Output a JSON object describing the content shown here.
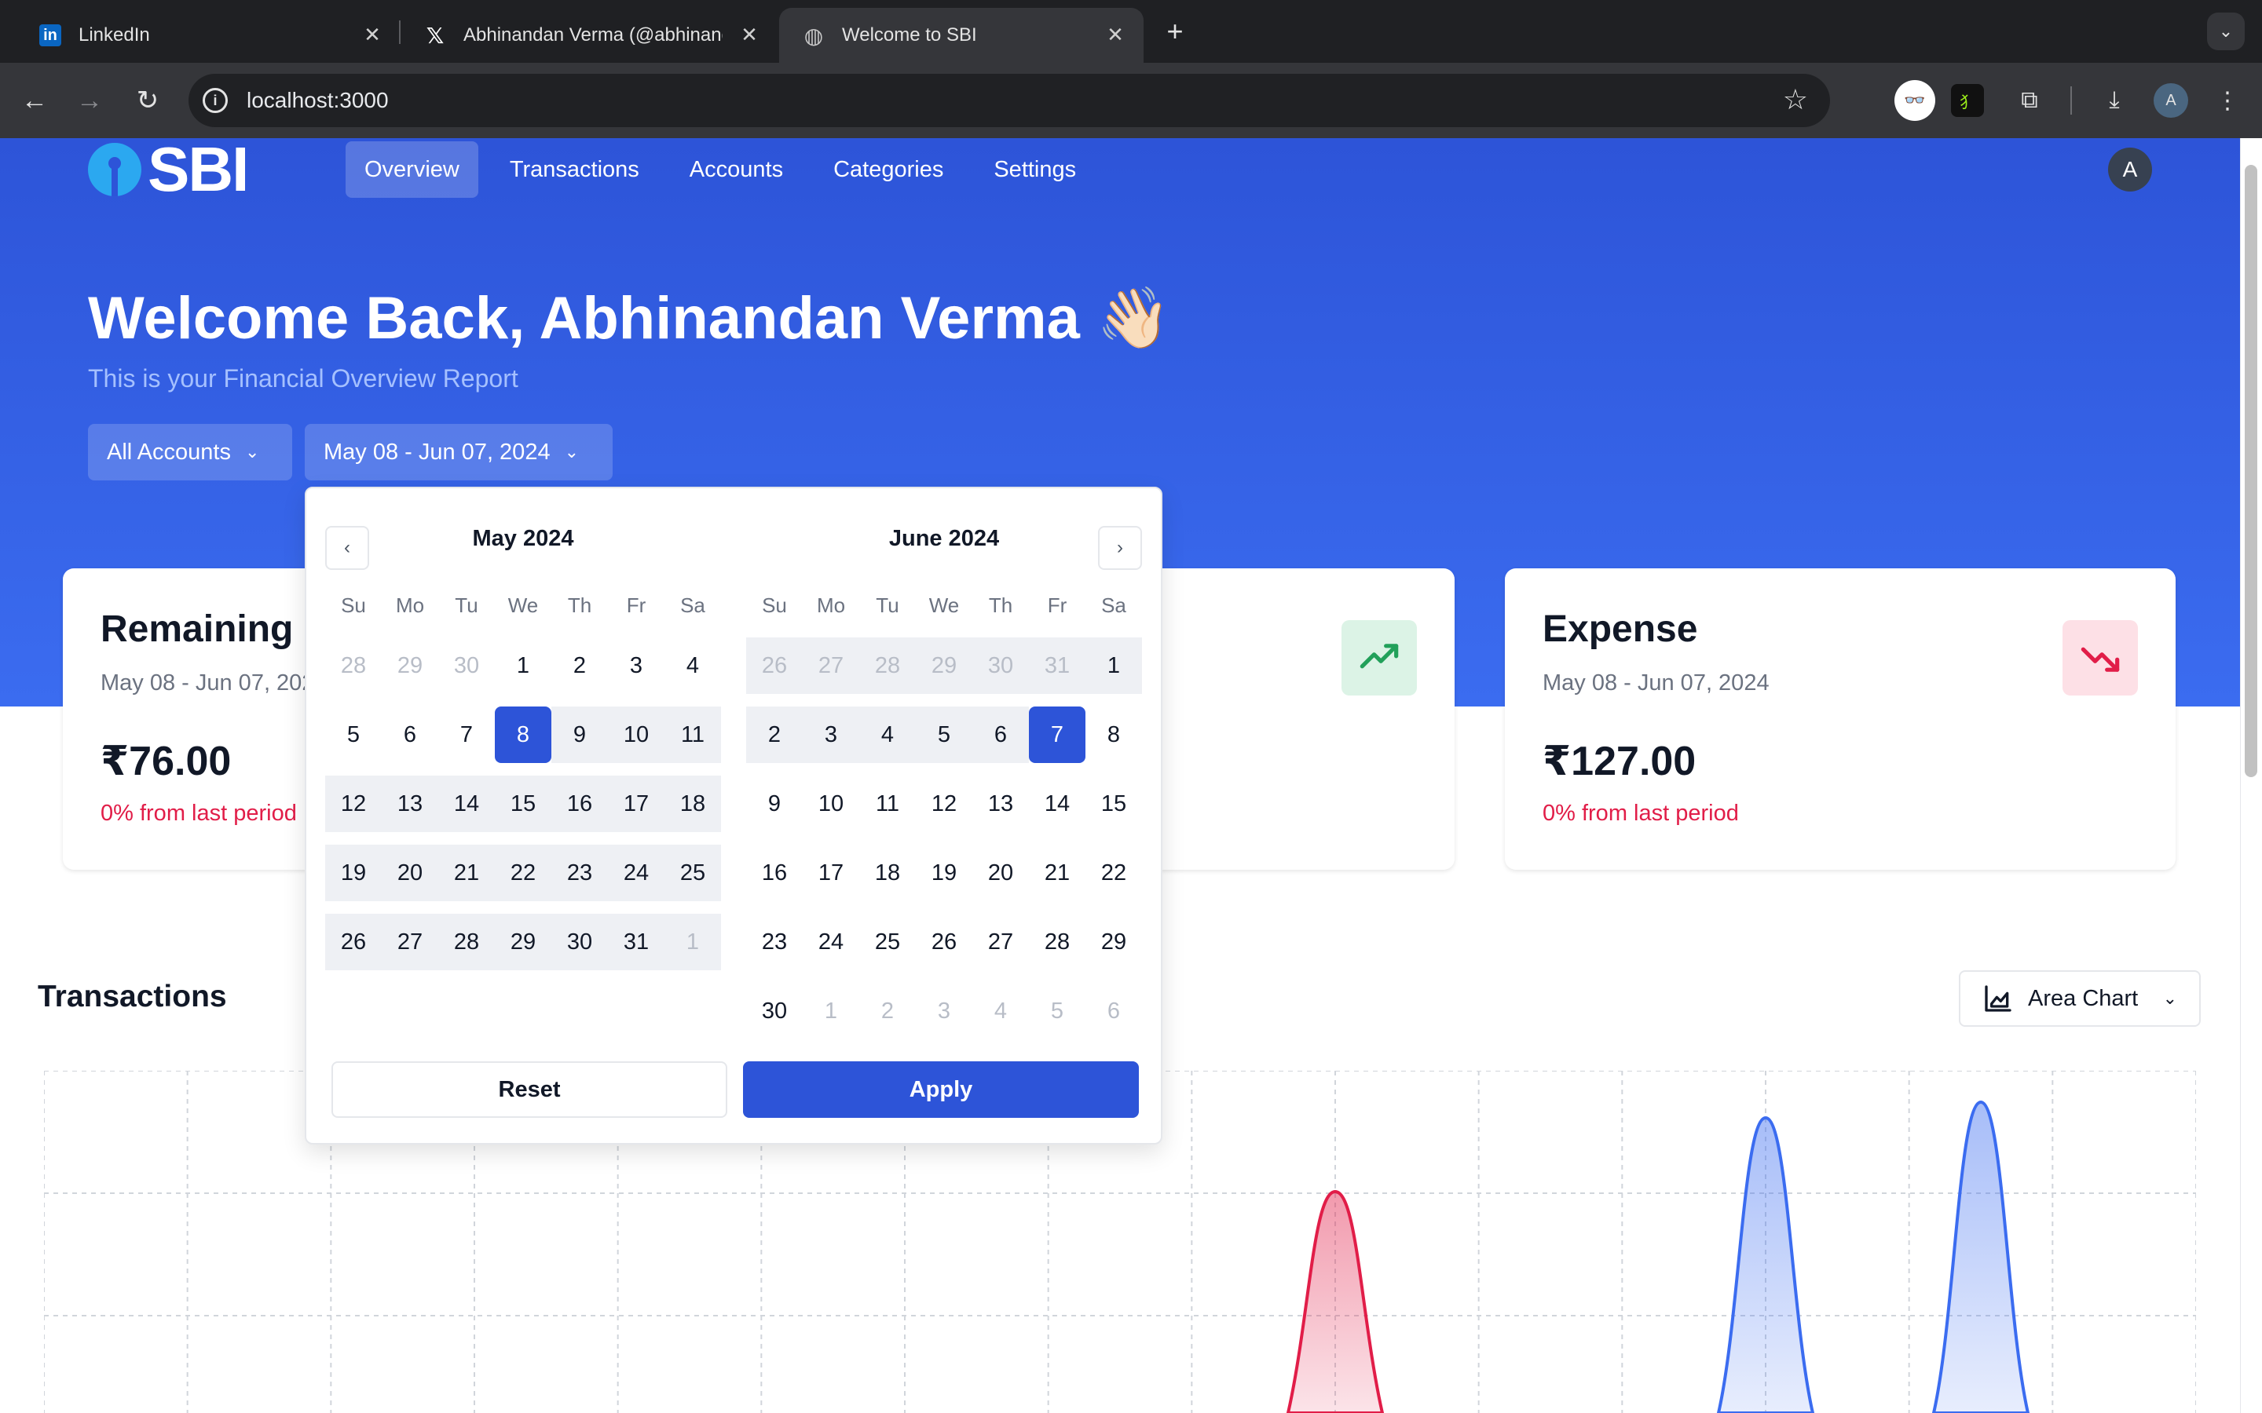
{
  "browser": {
    "tabs": [
      {
        "title": "LinkedIn",
        "icon": "linkedin-icon"
      },
      {
        "title": "Abhinandan Verma (@abhinandan",
        "icon": "x-icon"
      },
      {
        "title": "Welcome to SBI",
        "icon": "globe-icon"
      }
    ],
    "url": "localhost:3000",
    "profile_initial": "A"
  },
  "app": {
    "logo_text": "SBI",
    "brand_color": "#2d54d8",
    "nav": [
      "Overview",
      "Transactions",
      "Accounts",
      "Categories",
      "Settings"
    ],
    "active_nav": "Overview",
    "user_initial": "A",
    "welcome": "Welcome Back, Abhinandan Verma 👋🏻",
    "subtitle": "This is your Financial Overview Report",
    "filters": {
      "account": "All Accounts",
      "date_range": "May 08 - Jun 07, 2024"
    },
    "cards": [
      {
        "title": "Remaining",
        "range": "May 08 - Jun 07, 2024",
        "amount": "₹76.00",
        "change": "0% from last period"
      },
      {
        "title": "Expense",
        "range": "May 08 - Jun 07, 2024",
        "amount": "₹127.00",
        "change": "0% from last period",
        "trend": "down"
      }
    ],
    "income_trend": "up",
    "transactions": {
      "title": "Transactions",
      "chart_type_label": "Area Chart"
    }
  },
  "datepicker": {
    "weekdays": [
      "Su",
      "Mo",
      "Tu",
      "We",
      "Th",
      "Fr",
      "Sa"
    ],
    "months": [
      {
        "label": "May 2024",
        "weeks": [
          [
            [
              "28",
              "out"
            ],
            [
              "29",
              "out"
            ],
            [
              "30",
              "out"
            ],
            [
              "1",
              ""
            ],
            [
              "2",
              ""
            ],
            [
              "3",
              ""
            ],
            [
              "4",
              ""
            ]
          ],
          [
            [
              "5",
              ""
            ],
            [
              "6",
              ""
            ],
            [
              "7",
              ""
            ],
            [
              "8",
              "sel"
            ],
            [
              "9",
              "in"
            ],
            [
              "10",
              "in"
            ],
            [
              "11",
              "in"
            ]
          ],
          [
            [
              "12",
              "in"
            ],
            [
              "13",
              "in"
            ],
            [
              "14",
              "in"
            ],
            [
              "15",
              "in"
            ],
            [
              "16",
              "in"
            ],
            [
              "17",
              "in"
            ],
            [
              "18",
              "in"
            ]
          ],
          [
            [
              "19",
              "in"
            ],
            [
              "20",
              "in"
            ],
            [
              "21",
              "in"
            ],
            [
              "22",
              "in"
            ],
            [
              "23",
              "in"
            ],
            [
              "24",
              "in"
            ],
            [
              "25",
              "in"
            ]
          ],
          [
            [
              "26",
              "in"
            ],
            [
              "27",
              "in"
            ],
            [
              "28",
              "in"
            ],
            [
              "29",
              "in"
            ],
            [
              "30",
              "in"
            ],
            [
              "31",
              "in"
            ],
            [
              "1",
              "outin"
            ]
          ]
        ]
      },
      {
        "label": "June 2024",
        "weeks": [
          [
            [
              "26",
              "outin"
            ],
            [
              "27",
              "outin"
            ],
            [
              "28",
              "outin"
            ],
            [
              "29",
              "outin"
            ],
            [
              "30",
              "outin"
            ],
            [
              "31",
              "outin"
            ],
            [
              "1",
              "in"
            ]
          ],
          [
            [
              "2",
              "in"
            ],
            [
              "3",
              "in"
            ],
            [
              "4",
              "in"
            ],
            [
              "5",
              "in"
            ],
            [
              "6",
              "in"
            ],
            [
              "7",
              "sel"
            ],
            [
              "8",
              ""
            ]
          ],
          [
            [
              "9",
              ""
            ],
            [
              "10",
              ""
            ],
            [
              "11",
              ""
            ],
            [
              "12",
              ""
            ],
            [
              "13",
              ""
            ],
            [
              "14",
              ""
            ],
            [
              "15",
              ""
            ]
          ],
          [
            [
              "16",
              ""
            ],
            [
              "17",
              ""
            ],
            [
              "18",
              ""
            ],
            [
              "19",
              ""
            ],
            [
              "20",
              ""
            ],
            [
              "21",
              ""
            ],
            [
              "22",
              ""
            ]
          ],
          [
            [
              "23",
              ""
            ],
            [
              "24",
              ""
            ],
            [
              "25",
              ""
            ],
            [
              "26",
              ""
            ],
            [
              "27",
              ""
            ],
            [
              "28",
              ""
            ],
            [
              "29",
              ""
            ]
          ],
          [
            [
              "30",
              ""
            ],
            [
              "1",
              "out"
            ],
            [
              "2",
              "out"
            ],
            [
              "3",
              "out"
            ],
            [
              "4",
              "out"
            ],
            [
              "5",
              "out"
            ],
            [
              "6",
              "out"
            ]
          ]
        ]
      }
    ],
    "reset_label": "Reset",
    "apply_label": "Apply"
  },
  "chart_data": {
    "type": "area",
    "series": [
      {
        "color": "#e11d48",
        "peak_index": 9
      },
      {
        "color": "#3b6cf0",
        "peak_index": 12
      },
      {
        "color": "#3b6cf0",
        "peak_index": 13.5
      }
    ],
    "grid": true,
    "note_visible": "chart cropped at bottom of viewport"
  }
}
